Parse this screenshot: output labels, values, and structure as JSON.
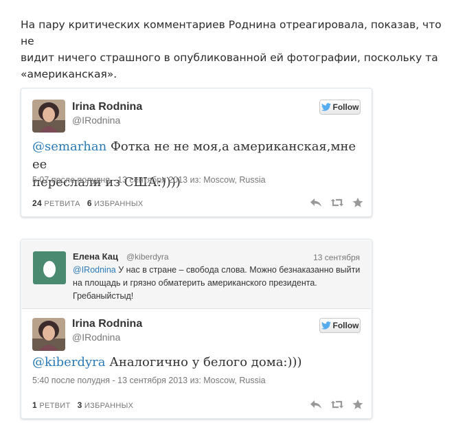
{
  "intro": {
    "line1": "На пару критических комментариев Роднина отреагировала, показав, что не",
    "line2": "видит ничего страшного в опубликованной ей фотографии, поскольку та",
    "line3": "«американская»."
  },
  "tweet1": {
    "name": "Irina Rodnina",
    "handle": "@IRodnina",
    "follow_label": "Follow",
    "mention": "@semarhan",
    "text_line1": " Фотка не не моя,а американская,мне ее",
    "text_line2": "переслали из США:))))",
    "meta": "5:07 после полудня - 13 сентября 2013 из: Moscow, Russia",
    "retweets_count": "24",
    "retweets_label": "РЕТВИТА",
    "favorites_count": "6",
    "favorites_label": "ИЗБРАННЫХ"
  },
  "context_tweet": {
    "name": "Елена Кац",
    "handle": "@kiberdyra",
    "date": "13 сентября",
    "mention": "@IRodnina",
    "text_line1": " У нас в стране – свобода слова. Можно безнаказанно выйти",
    "text_line2": "на площадь и грязно обматерить американского президента.",
    "text_line3": "Гребаныйстыд!"
  },
  "tweet2": {
    "name": "Irina Rodnina",
    "handle": "@IRodnina",
    "follow_label": "Follow",
    "mention": "@kiberdyra",
    "text_line1": " Аналогично у белого дома:)))",
    "meta": "5:40 после полудня - 13 сентября 2013 из: Moscow, Russia",
    "retweets_count": "1",
    "retweets_label": "РЕТВИТ",
    "favorites_count": "3",
    "favorites_label": "ИЗБРАННЫХ"
  },
  "colors": {
    "link": "#2a7ab8",
    "twitter_bird": "#55acee",
    "egg_background": "#4a8a70"
  }
}
